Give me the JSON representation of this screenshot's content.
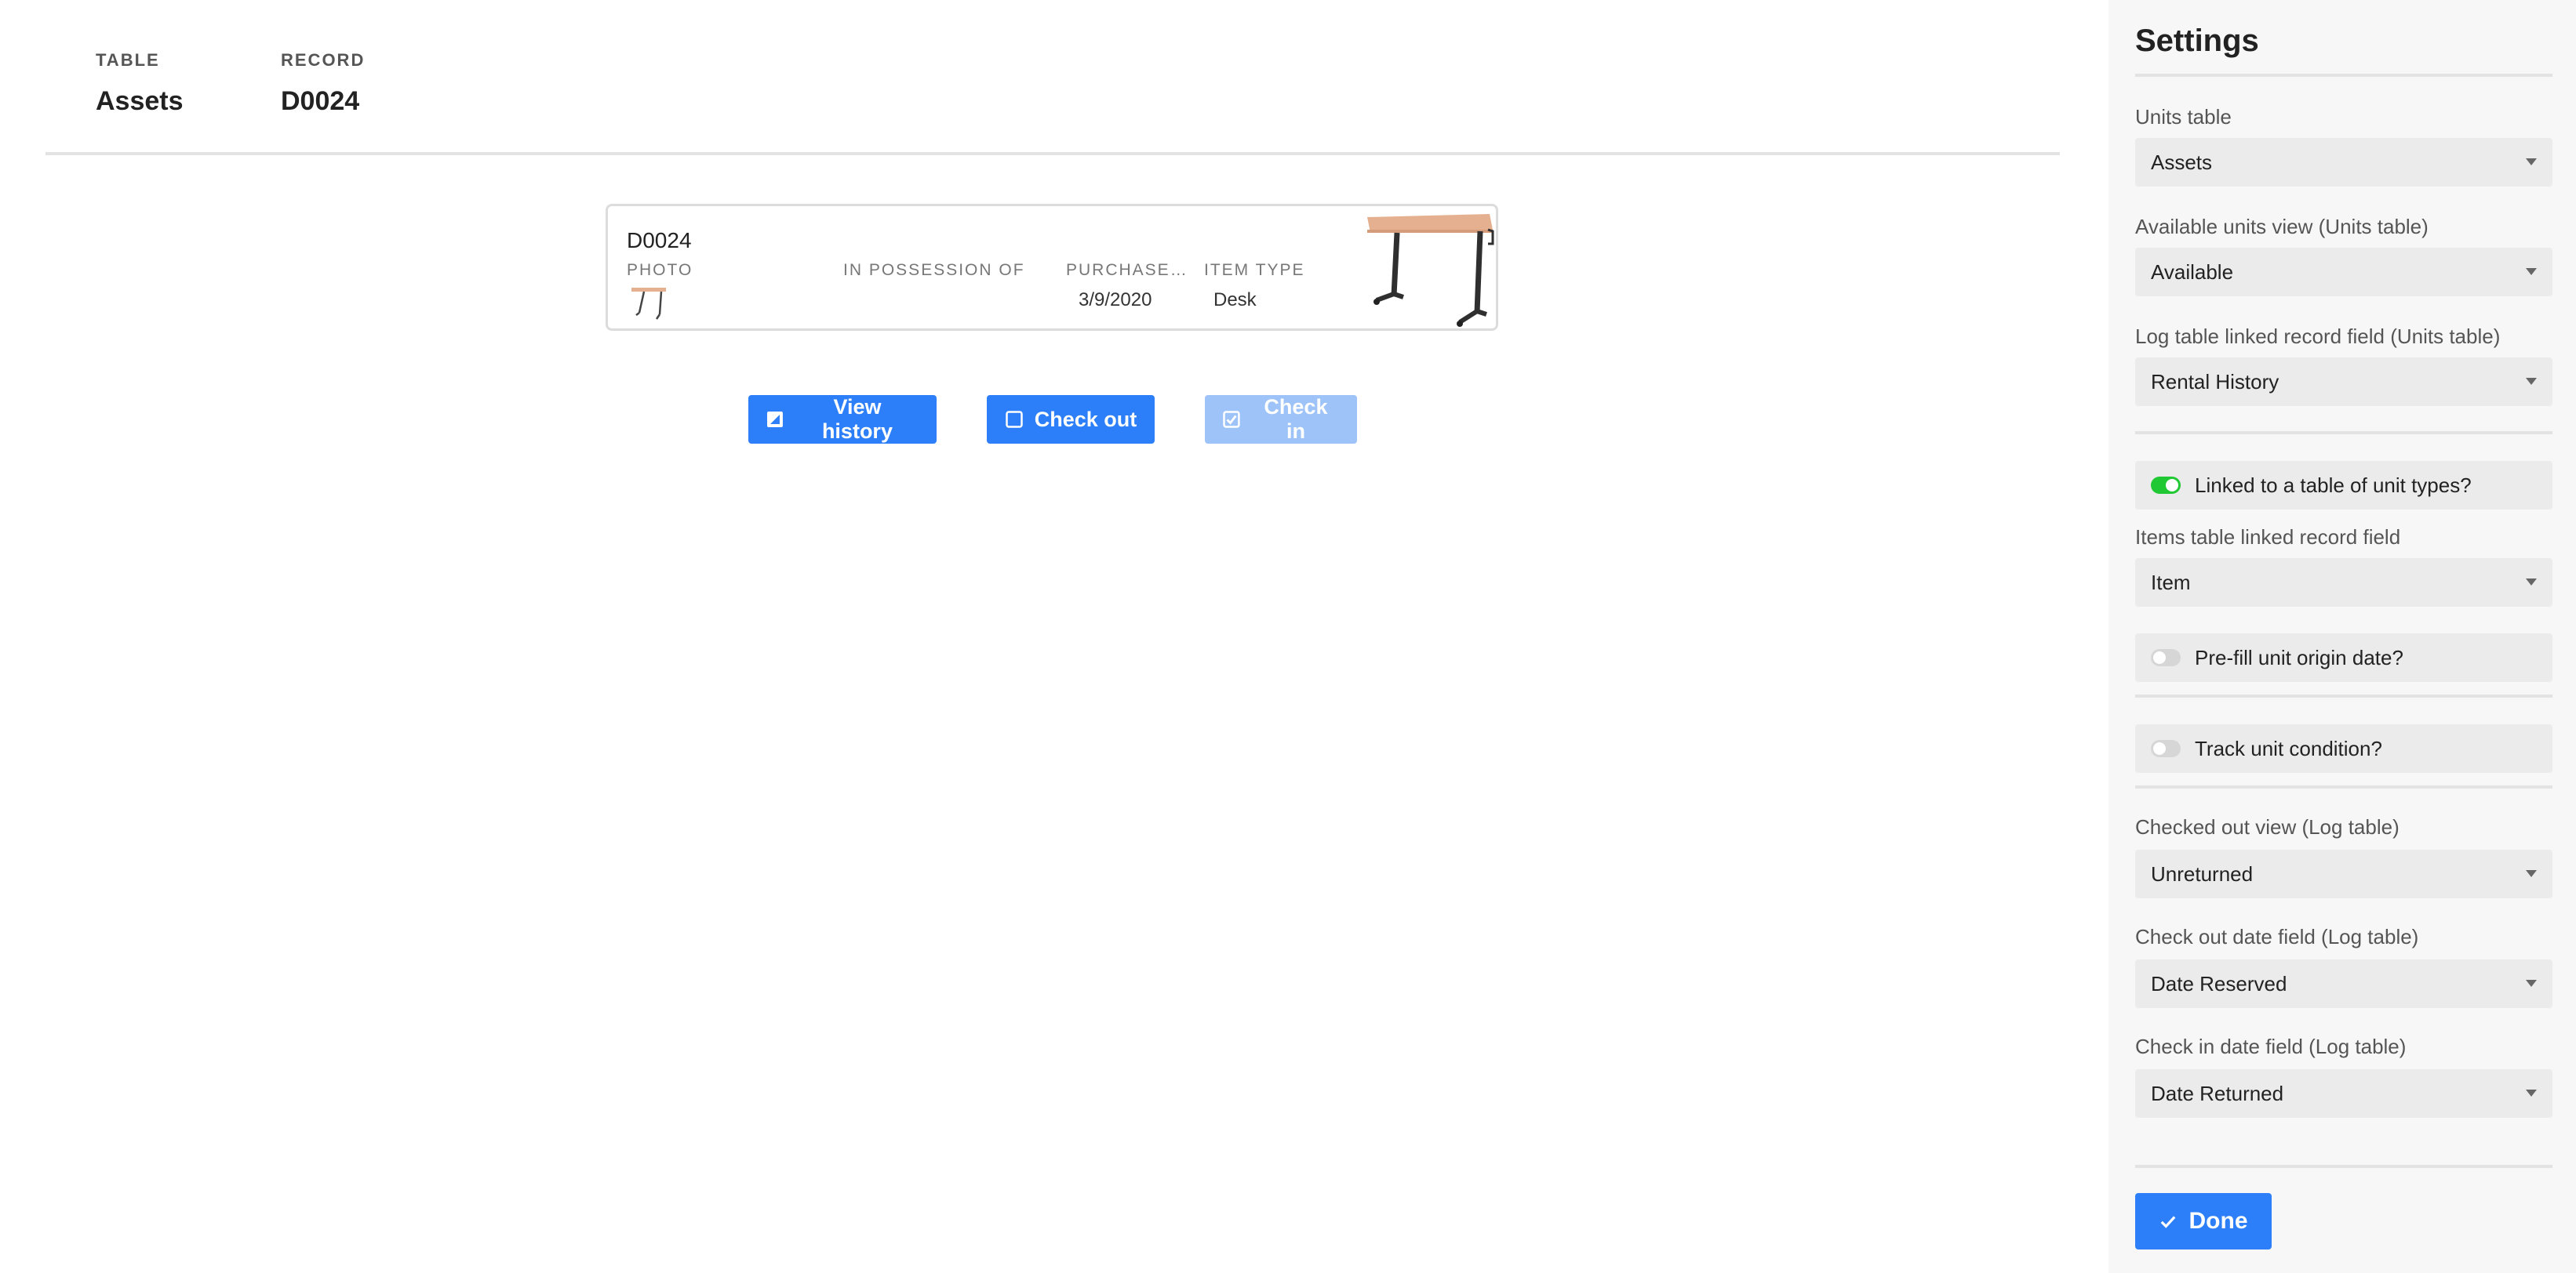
{
  "header": {
    "table_label": "TABLE",
    "table_value": "Assets",
    "record_label": "RECORD",
    "record_value": "D0024"
  },
  "card": {
    "title": "D0024",
    "photo_label": "PHOTO",
    "possession_label": "IN POSSESSION OF",
    "purchase_label": "PURCHASE…",
    "purchase_value": "3/9/2020",
    "item_type_label": "ITEM TYPE",
    "item_type_value": "Desk"
  },
  "actions": {
    "view_history": "View history",
    "check_out": "Check out",
    "check_in": "Check in"
  },
  "settings": {
    "title": "Settings",
    "units_table_label": "Units table",
    "units_table_value": "Assets",
    "available_view_label": "Available units view (Units table)",
    "available_view_value": "Available",
    "log_link_label": "Log table linked record field (Units table)",
    "log_link_value": "Rental History",
    "linked_types_toggle": "Linked to a table of unit types?",
    "items_link_label": "Items table linked record field",
    "items_link_value": "Item",
    "prefill_toggle": "Pre-fill unit origin date?",
    "condition_toggle": "Track unit condition?",
    "checked_out_view_label": "Checked out view (Log table)",
    "checked_out_view_value": "Unreturned",
    "checkout_date_label": "Check out date field (Log table)",
    "checkout_date_value": "Date Reserved",
    "checkin_date_label": "Check in date field (Log table)",
    "checkin_date_value": "Date Returned",
    "done_label": "Done"
  },
  "colors": {
    "primary": "#2d7ff9",
    "primary_disabled": "#9ec3f8",
    "toggle_on": "#20c933",
    "toggle_off": "#d6d6d6",
    "panel_bg": "#f7f7f7"
  }
}
